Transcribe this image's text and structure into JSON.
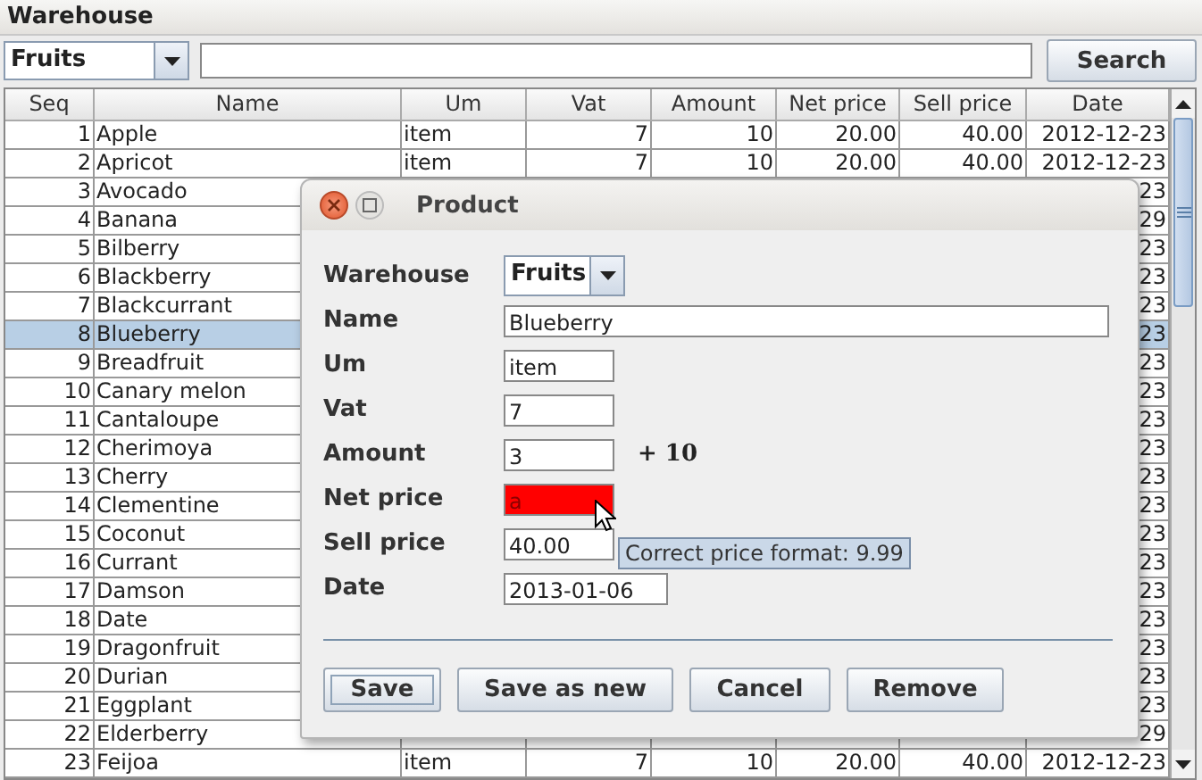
{
  "window": {
    "title": "Warehouse"
  },
  "toolbar": {
    "category": "Fruits",
    "search_button": "Search"
  },
  "table": {
    "columns": [
      "Seq",
      "Name",
      "Um",
      "Vat",
      "Amount",
      "Net price",
      "Sell price",
      "Date"
    ],
    "rows": [
      {
        "seq": "1",
        "name": "Apple",
        "um": "item",
        "vat": "7",
        "amount": "10",
        "net_price": "20.00",
        "sell_price": "40.00",
        "date": "2012-12-23",
        "selected": false
      },
      {
        "seq": "2",
        "name": "Apricot",
        "um": "item",
        "vat": "7",
        "amount": "10",
        "net_price": "20.00",
        "sell_price": "40.00",
        "date": "2012-12-23",
        "selected": false
      },
      {
        "seq": "3",
        "name": "Avocado",
        "date": "23",
        "selected": false
      },
      {
        "seq": "4",
        "name": "Banana",
        "date": "29",
        "selected": false
      },
      {
        "seq": "5",
        "name": "Bilberry",
        "date": "23",
        "selected": false
      },
      {
        "seq": "6",
        "name": "Blackberry",
        "date": "23",
        "selected": false
      },
      {
        "seq": "7",
        "name": "Blackcurrant",
        "date": "23",
        "selected": false
      },
      {
        "seq": "8",
        "name": "Blueberry",
        "date": "23",
        "selected": true
      },
      {
        "seq": "9",
        "name": "Breadfruit",
        "date": "23",
        "selected": false
      },
      {
        "seq": "10",
        "name": "Canary melon",
        "date": "23",
        "selected": false
      },
      {
        "seq": "11",
        "name": "Cantaloupe",
        "date": "23",
        "selected": false
      },
      {
        "seq": "12",
        "name": "Cherimoya",
        "date": "23",
        "selected": false
      },
      {
        "seq": "13",
        "name": "Cherry",
        "date": "23",
        "selected": false
      },
      {
        "seq": "14",
        "name": "Clementine",
        "date": "23",
        "selected": false
      },
      {
        "seq": "15",
        "name": "Coconut",
        "date": "23",
        "selected": false
      },
      {
        "seq": "16",
        "name": "Currant",
        "date": "23",
        "selected": false
      },
      {
        "seq": "17",
        "name": "Damson",
        "date": "23",
        "selected": false
      },
      {
        "seq": "18",
        "name": "Date",
        "date": "23",
        "selected": false
      },
      {
        "seq": "19",
        "name": "Dragonfruit",
        "date": "23",
        "selected": false
      },
      {
        "seq": "20",
        "name": "Durian",
        "date": "23",
        "selected": false
      },
      {
        "seq": "21",
        "name": "Eggplant",
        "date": "23",
        "selected": false
      },
      {
        "seq": "22",
        "name": "Elderberry",
        "date": "29",
        "selected": false
      },
      {
        "seq": "23",
        "name": "Feijoa",
        "um": "item",
        "vat": "7",
        "amount": "10",
        "net_price": "20.00",
        "sell_price": "40.00",
        "date": "2012-12-23",
        "selected": false
      }
    ]
  },
  "dialog": {
    "title": "Product",
    "fields": [
      {
        "label": "Warehouse",
        "kind": "dropdown",
        "value": "Fruits"
      },
      {
        "label": "Name",
        "kind": "text",
        "value": "Blueberry"
      },
      {
        "label": "Um",
        "kind": "text",
        "value": "item"
      },
      {
        "label": "Vat",
        "kind": "text",
        "value": "7"
      },
      {
        "label": "Amount",
        "kind": "text",
        "value": "3",
        "suffix": "+ 10"
      },
      {
        "label": "Net price",
        "kind": "text",
        "value": "a",
        "invalid": true
      },
      {
        "label": "Sell price",
        "kind": "text",
        "value": "40.00"
      },
      {
        "label": "Date",
        "kind": "text",
        "value": "2013-01-06"
      }
    ],
    "tooltip": "Correct price format: 9.99",
    "buttons": [
      {
        "label": "Save",
        "focused": true
      },
      {
        "label": "Save as new",
        "focused": false
      },
      {
        "label": "Cancel",
        "focused": false
      },
      {
        "label": "Remove",
        "focused": false
      }
    ]
  }
}
